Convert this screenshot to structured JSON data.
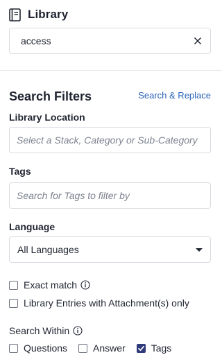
{
  "header": {
    "title": "Library",
    "icon": "book-icon"
  },
  "search": {
    "value": "access",
    "clear_icon": "close-icon"
  },
  "filters": {
    "title": "Search Filters",
    "replace_link": "Search & Replace",
    "location": {
      "label": "Library Location",
      "placeholder": "Select a Stack, Category or Sub-Category"
    },
    "tags": {
      "label": "Tags",
      "placeholder": "Search for Tags to filter by"
    },
    "language": {
      "label": "Language",
      "selected": "All Languages"
    },
    "exact_match": {
      "label": "Exact match",
      "checked": false
    },
    "attachments_only": {
      "label": "Library Entries with Attachment(s) only",
      "checked": false
    },
    "search_within": {
      "label": "Search Within",
      "options": [
        {
          "label": "Questions",
          "checked": false
        },
        {
          "label": "Answer",
          "checked": false
        },
        {
          "label": "Tags",
          "checked": true
        }
      ]
    }
  },
  "colors": {
    "accent_link": "#2a63b8",
    "checkbox_checked": "#2f3a7a",
    "border": "#d8dbe0",
    "text": "#1f2430"
  }
}
